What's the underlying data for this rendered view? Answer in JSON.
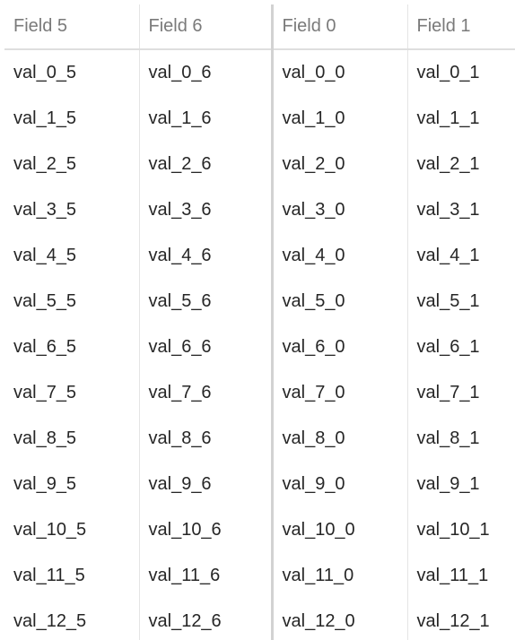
{
  "table": {
    "columns": [
      "Field 5",
      "Field 6",
      "Field 0",
      "Field 1"
    ],
    "rows": [
      [
        "val_0_5",
        "val_0_6",
        "val_0_0",
        "val_0_1"
      ],
      [
        "val_1_5",
        "val_1_6",
        "val_1_0",
        "val_1_1"
      ],
      [
        "val_2_5",
        "val_2_6",
        "val_2_0",
        "val_2_1"
      ],
      [
        "val_3_5",
        "val_3_6",
        "val_3_0",
        "val_3_1"
      ],
      [
        "val_4_5",
        "val_4_6",
        "val_4_0",
        "val_4_1"
      ],
      [
        "val_5_5",
        "val_5_6",
        "val_5_0",
        "val_5_1"
      ],
      [
        "val_6_5",
        "val_6_6",
        "val_6_0",
        "val_6_1"
      ],
      [
        "val_7_5",
        "val_7_6",
        "val_7_0",
        "val_7_1"
      ],
      [
        "val_8_5",
        "val_8_6",
        "val_8_0",
        "val_8_1"
      ],
      [
        "val_9_5",
        "val_9_6",
        "val_9_0",
        "val_9_1"
      ],
      [
        "val_10_5",
        "val_10_6",
        "val_10_0",
        "val_10_1"
      ],
      [
        "val_11_5",
        "val_11_6",
        "val_11_0",
        "val_11_1"
      ],
      [
        "val_12_5",
        "val_12_6",
        "val_12_0",
        "val_12_1"
      ]
    ]
  },
  "colors": {
    "header_text": "#7a7a7a",
    "cell_text": "#262626",
    "divider": "#d2d2d2",
    "grid_line": "#e4e4e4"
  }
}
